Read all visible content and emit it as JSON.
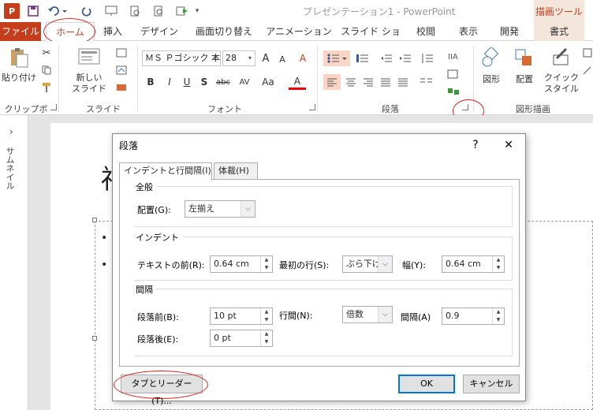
{
  "titlebar": {
    "app_icon": "P",
    "doc_title": "プレゼンテーション1 - PowerPoint",
    "context_tool_header": "描画ツール"
  },
  "qat": {
    "save_icon": "save-icon",
    "undo_icon": "undo-icon",
    "redo_icon": "redo-icon",
    "start_from_beginning_icon": "start-slideshow-icon",
    "print_preview_icon": "print-preview-icon",
    "more_icon": "customize-qat-icon"
  },
  "tabs": [
    {
      "label": "ファイル"
    },
    {
      "label": "ホーム"
    },
    {
      "label": "挿入"
    },
    {
      "label": "デザイン"
    },
    {
      "label": "画面切り替え"
    },
    {
      "label": "アニメーション"
    },
    {
      "label": "スライド ショー"
    },
    {
      "label": "校閲"
    },
    {
      "label": "表示"
    },
    {
      "label": "開発"
    },
    {
      "label": "書式"
    }
  ],
  "ribbon": {
    "clipboard": {
      "paste": "貼り付け",
      "label": "クリップボード"
    },
    "slides": {
      "new_slide": "新しい\nスライド",
      "label": "スライド"
    },
    "font": {
      "name": "ＭＳ Ｐゴシック 本",
      "size": "28",
      "bold": "B",
      "italic": "I",
      "underline": "U",
      "shadow": "S",
      "strike": "abc",
      "spacing": "AV",
      "case": "Aa",
      "color": "A",
      "grow": "A",
      "shrink": "A",
      "clear": "A",
      "label": "フォント"
    },
    "paragraph": {
      "label": "段落"
    },
    "drawing": {
      "shapes": "図形",
      "arrange": "配置",
      "quick_styles": "クイック\nスタイル",
      "label": "図形描画"
    }
  },
  "thumbnail_pane": {
    "label": "サムネイル",
    "toggle": "›"
  },
  "slide": {
    "title_glyph": "福",
    "bullets": [
      "•",
      "•"
    ]
  },
  "dialog": {
    "title": "段落",
    "help": "?",
    "close": "✕",
    "tabs": [
      {
        "label": "インデントと行間隔(I)"
      },
      {
        "label": "体裁(H)"
      }
    ],
    "general": {
      "title": "全般",
      "alignment_label": "配置(G):",
      "alignment_value": "左揃え"
    },
    "indent": {
      "title": "インデント",
      "before_text_label": "テキストの前(R):",
      "before_text_value": "0.64 cm",
      "special_label": "最初の行(S):",
      "special_value": "ぶら下げ",
      "by_label": "幅(Y):",
      "by_value": "0.64 cm"
    },
    "spacing": {
      "title": "間隔",
      "before_label": "段落前(B):",
      "before_value": "10 pt",
      "after_label": "段落後(E):",
      "after_value": "0 pt",
      "line_spacing_label": "行間(N):",
      "line_spacing_value": "倍数",
      "at_label": "間隔(A)",
      "at_value": "0.9"
    },
    "buttons": {
      "tabs": "タブとリーダー(T)...",
      "ok": "OK",
      "cancel": "キャンセル"
    }
  },
  "colors": {
    "accent": "#c43e1c",
    "highlight_ellipse": "#e0201b",
    "default_button": "#0078d7"
  }
}
